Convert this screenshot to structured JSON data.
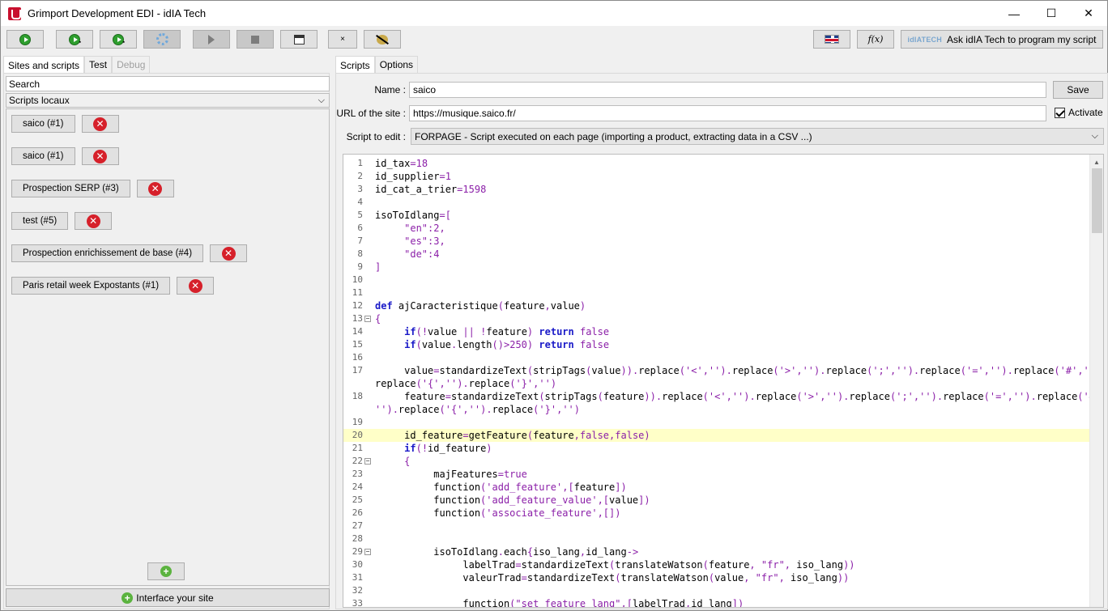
{
  "window": {
    "title": "Grimport Development EDI - idIA Tech",
    "controls": {
      "minimize": "—",
      "maximize": "☐",
      "close": "✕"
    }
  },
  "toolbar": {
    "close_label": "×",
    "fx_label": "f(x)",
    "ask_label": "Ask idIA Tech to program my script",
    "ask_logo": "idIATECH"
  },
  "left": {
    "tabs": [
      "Sites and scripts",
      "Test",
      "Debug"
    ],
    "search_placeholder": "Search",
    "scripts_select": "Scripts locaux",
    "scripts": [
      "saico (#1)",
      "saico (#1)",
      "Prospection SERP (#3)",
      "test (#5)",
      "Prospection enrichissement de base (#4)",
      "Paris retail week Expostants (#1)"
    ],
    "add_label": "+",
    "interface_label": "Interface your site"
  },
  "right": {
    "tabs": [
      "Scripts",
      "Options"
    ],
    "name_label": "Name :",
    "name_value": "saico",
    "save_label": "Save",
    "url_label": "URL of the site :",
    "url_value": "https://musique.saico.fr/",
    "activate_label": "Activate",
    "script_label": "Script to edit :",
    "script_value": "FORPAGE - Script executed on each page (importing a product, extracting data in a CSV ...)"
  },
  "editor": {
    "lines": [
      {
        "n": "1",
        "code": "id_tax=18"
      },
      {
        "n": "2",
        "code": "id_supplier=1"
      },
      {
        "n": "3",
        "code": "id_cat_a_trier=1598"
      },
      {
        "n": "4",
        "code": ""
      },
      {
        "n": "5",
        "code": "isoToIdlang=["
      },
      {
        "n": "6",
        "code": "     \"en\":2,"
      },
      {
        "n": "7",
        "code": "     \"es\":3,"
      },
      {
        "n": "8",
        "code": "     \"de\":4"
      },
      {
        "n": "9",
        "code": "]"
      },
      {
        "n": "10",
        "code": ""
      },
      {
        "n": "11",
        "code": ""
      },
      {
        "n": "12",
        "code": "def ajCaracteristique(feature,value)"
      },
      {
        "n": "13",
        "code": "{",
        "fold": true
      },
      {
        "n": "14",
        "code": "     if(!value || !feature) return false"
      },
      {
        "n": "15",
        "code": "     if(value.length()>250) return false"
      },
      {
        "n": "16",
        "code": ""
      },
      {
        "n": "17",
        "code": "     value=standardizeText(stripTags(value)).replace('<','').replace('>','').replace(';','').replace('=','').replace('#','')."
      },
      {
        "n": "",
        "code": "replace('{','').replace('}','')"
      },
      {
        "n": "18",
        "code": "     feature=standardizeText(stripTags(feature)).replace('<','').replace('>','').replace(';','').replace('=','').replace('#',"
      },
      {
        "n": "",
        "code": "'').replace('{','').replace('}','')"
      },
      {
        "n": "19",
        "code": ""
      },
      {
        "n": "20",
        "code": "     id_feature=getFeature(feature,false,false)",
        "hl": true
      },
      {
        "n": "21",
        "code": "     if(!id_feature)"
      },
      {
        "n": "22",
        "code": "     {",
        "fold": true
      },
      {
        "n": "23",
        "code": "          majFeatures=true"
      },
      {
        "n": "24",
        "code": "          function('add_feature',[feature])"
      },
      {
        "n": "25",
        "code": "          function('add_feature_value',[value])"
      },
      {
        "n": "26",
        "code": "          function('associate_feature',[])"
      },
      {
        "n": "27",
        "code": ""
      },
      {
        "n": "28",
        "code": ""
      },
      {
        "n": "29",
        "code": "          isoToIdlang.each{iso_lang,id_lang->",
        "fold": true
      },
      {
        "n": "30",
        "code": "               labelTrad=standardizeText(translateWatson(feature, \"fr\", iso_lang))"
      },
      {
        "n": "31",
        "code": "               valeurTrad=standardizeText(translateWatson(value, \"fr\", iso_lang))"
      },
      {
        "n": "32",
        "code": ""
      },
      {
        "n": "33",
        "code": "               function(\"set_feature_lang\",[labelTrad,id_lang])"
      }
    ]
  },
  "colors": {
    "keyword": "#1a1ac8",
    "number": "#8b1fa8",
    "string": "#8b1fa8",
    "delete_red": "#d6202a",
    "add_green": "#5bb33f",
    "highlight_line": "#ffffc8"
  }
}
